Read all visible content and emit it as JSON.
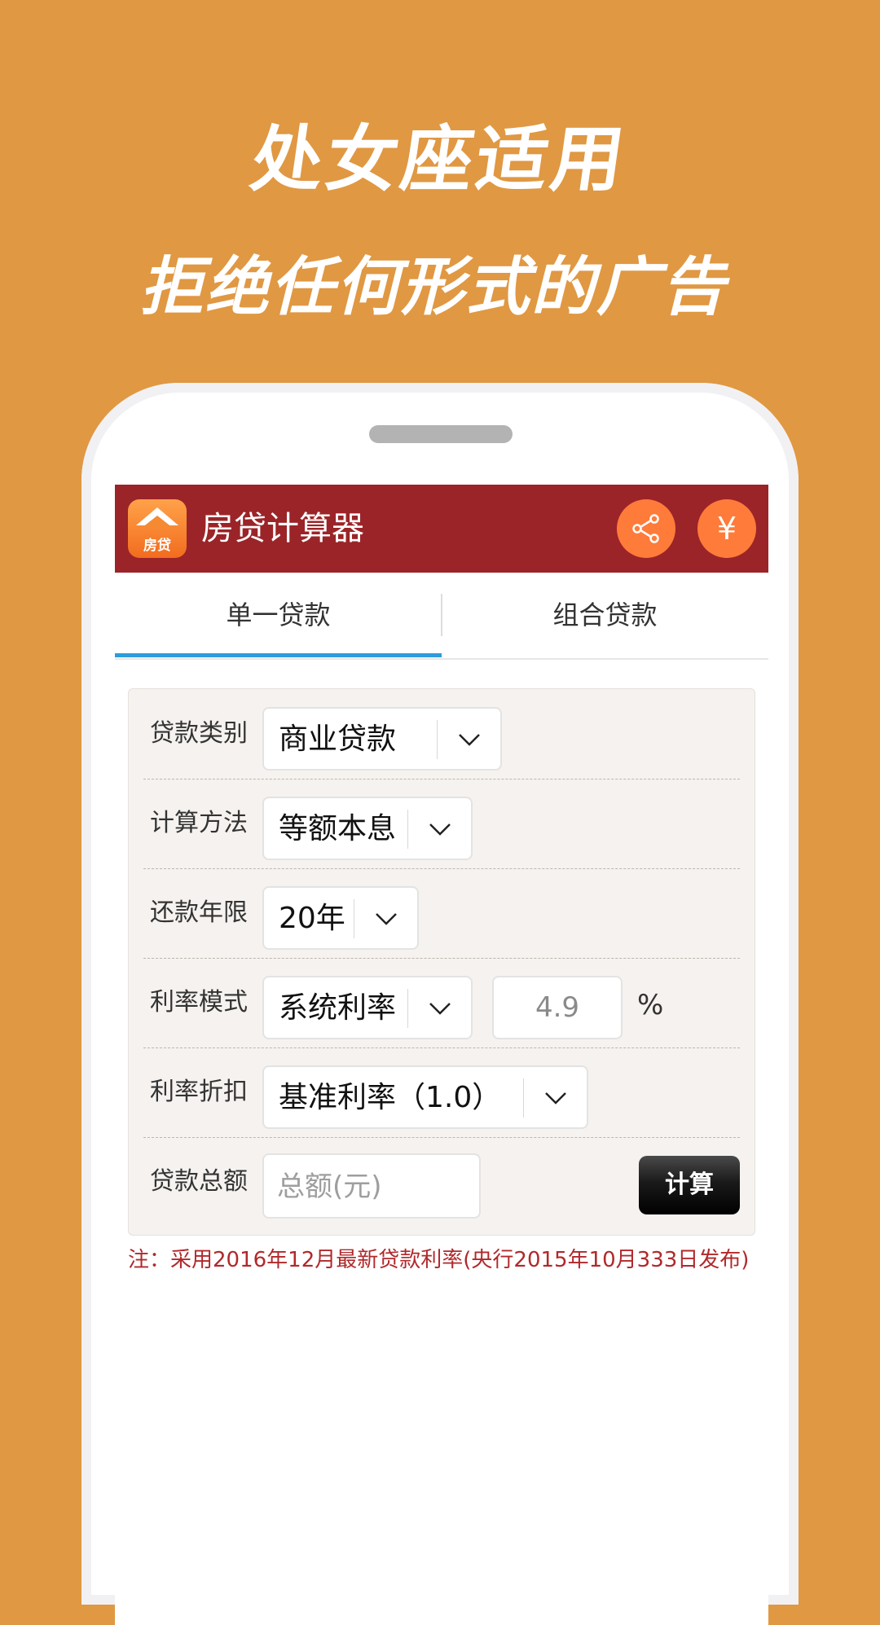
{
  "promo": {
    "line1": "处女座适用",
    "line2": "拒绝任何形式的广告"
  },
  "app": {
    "logo_text": "房贷",
    "title": "房贷计算器",
    "share_icon": "share-icon",
    "yuan_symbol": "¥"
  },
  "tabs": [
    {
      "label": "单一贷款",
      "active": true
    },
    {
      "label": "组合贷款",
      "active": false
    }
  ],
  "form": {
    "loan_type": {
      "label": "贷款类别",
      "value": "商业贷款"
    },
    "calc_method": {
      "label": "计算方法",
      "value": "等额本息"
    },
    "years": {
      "label": "还款年限",
      "value": "20年"
    },
    "rate_mode": {
      "label": "利率模式",
      "value": "系统利率",
      "rate": "4.9",
      "unit": "%"
    },
    "rate_discount": {
      "label": "利率折扣",
      "value": "基准利率（1.0）"
    },
    "amount": {
      "label": "贷款总额",
      "placeholder": "总额(元)"
    },
    "calc_button": "计算"
  },
  "note": "注：采用2016年12月最新贷款利率(央行2015年10月333日发布)",
  "colors": {
    "background": "#E09843",
    "appbar": "#9B2428",
    "accent_button": "#FF7B3A",
    "tab_indicator": "#2D9CDB",
    "note_text": "#B0292C"
  }
}
